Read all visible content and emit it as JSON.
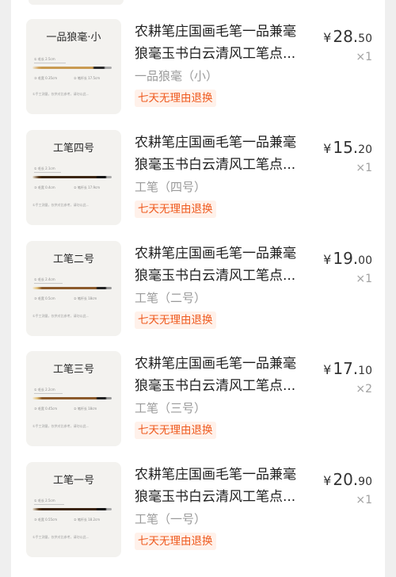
{
  "items": [
    {
      "thumb_title": "一品狼毫·小",
      "spec_a": "① 毛长 2.5cm",
      "spec_b": "② 笔杆长 17.5cm",
      "spec_c": "③ 毛宽 0.35cm",
      "note": "①手工测量，仅供对比参考，请勿以此...",
      "title_line1": "农耕笔庄国画毛笔一品兼毫",
      "title_line2": "狼毫玉书白云清风工笔点...",
      "variant": "一品狼毫（小）",
      "badge": "七天无理由退换",
      "price_symbol": "¥",
      "price_int": "28.",
      "price_dec": "50",
      "qty": "×1",
      "brush_style": "gold"
    },
    {
      "thumb_title": "工笔四号",
      "spec_a": "① 毛长 2.1cm",
      "spec_b": "② 笔杆长 17.9cm",
      "spec_c": "③ 毛宽 0.4cm",
      "note": "①手工测量，仅供对比参考，请勿以此...",
      "title_line1": "农耕笔庄国画毛笔一品兼毫",
      "title_line2": "狼毫玉书白云清风工笔点...",
      "variant": "工笔（四号）",
      "badge": "七天无理由退换",
      "price_symbol": "¥",
      "price_int": "15.",
      "price_dec": "20",
      "qty": "×1",
      "brush_style": "dark"
    },
    {
      "thumb_title": "工笔二号",
      "spec_a": "① 毛长 2.4cm",
      "spec_b": "② 笔杆长 18cm",
      "spec_c": "③ 毛宽 0.5cm",
      "note": "①手工测量，仅供对比参考，请勿以此...",
      "title_line1": "农耕笔庄国画毛笔一品兼毫",
      "title_line2": "狼毫玉书白云清风工笔点...",
      "variant": "工笔（二号）",
      "badge": "七天无理由退换",
      "price_symbol": "¥",
      "price_int": "19.",
      "price_dec": "00",
      "qty": "×1",
      "brush_style": "brown"
    },
    {
      "thumb_title": "工笔三号",
      "spec_a": "① 毛长 2.2cm",
      "spec_b": "② 笔杆长 18cm",
      "spec_c": "③ 毛宽 0.45cm",
      "note": "①手工测量，仅供对比参考，请勿以此...",
      "title_line1": "农耕笔庄国画毛笔一品兼毫",
      "title_line2": "狼毫玉书白云清风工笔点...",
      "variant": "工笔（三号）",
      "badge": "七天无理由退换",
      "price_symbol": "¥",
      "price_int": "17.",
      "price_dec": "10",
      "qty": "×2",
      "brush_style": "brown"
    },
    {
      "thumb_title": "工笔一号",
      "spec_a": "① 毛长 2.5cm",
      "spec_b": "② 笔杆长 18.2cm",
      "spec_c": "③ 毛宽 0.55cm",
      "note": "①手工测量，仅供对比参考，请勿以此...",
      "title_line1": "农耕笔庄国画毛笔一品兼毫",
      "title_line2": "狼毫玉书白云清风工笔点...",
      "variant": "工笔（一号）",
      "badge": "七天无理由退换",
      "price_symbol": "¥",
      "price_int": "20.",
      "price_dec": "90",
      "qty": "×1",
      "brush_style": "brown"
    }
  ],
  "colors": {
    "page_bg": "#efefef",
    "card_bg": "#ffffff",
    "thumb_bg": "#f3f2ef",
    "badge_text": "#ef5a1f",
    "badge_bg": "#fff1ea",
    "muted_text": "#9a9a9a"
  }
}
